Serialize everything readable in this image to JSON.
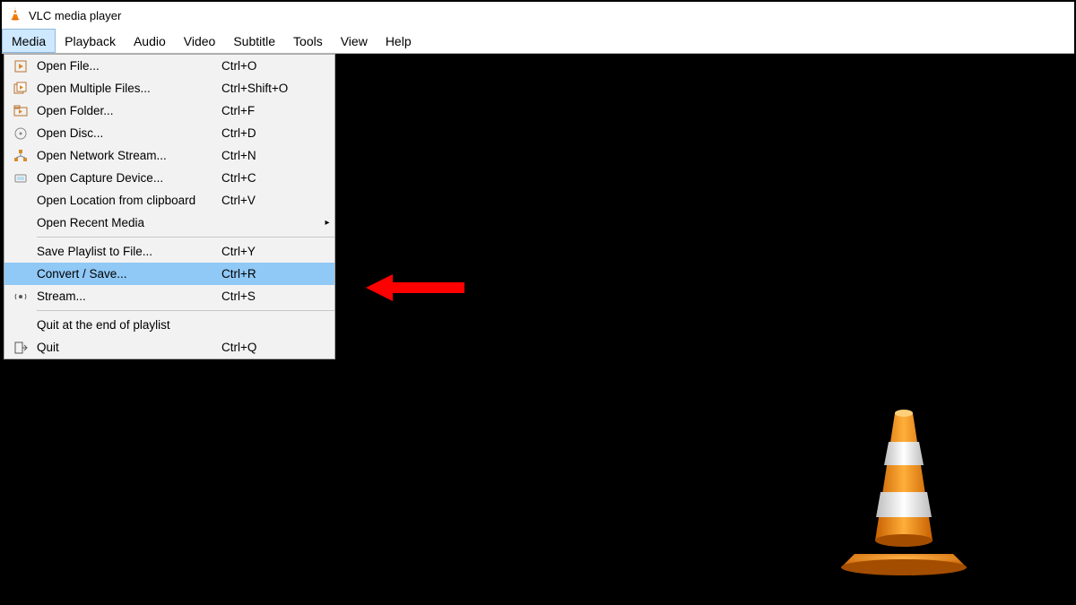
{
  "window": {
    "title": "VLC media player"
  },
  "menubar": {
    "items": [
      "Media",
      "Playback",
      "Audio",
      "Video",
      "Subtitle",
      "Tools",
      "View",
      "Help"
    ],
    "active_index": 0
  },
  "media_menu": {
    "groups": [
      [
        {
          "icon": "file-play-icon",
          "label": "Open File...",
          "shortcut": "Ctrl+O"
        },
        {
          "icon": "files-play-icon",
          "label": "Open Multiple Files...",
          "shortcut": "Ctrl+Shift+O"
        },
        {
          "icon": "folder-play-icon",
          "label": "Open Folder...",
          "shortcut": "Ctrl+F"
        },
        {
          "icon": "disc-icon",
          "label": "Open Disc...",
          "shortcut": "Ctrl+D"
        },
        {
          "icon": "network-icon",
          "label": "Open Network Stream...",
          "shortcut": "Ctrl+N"
        },
        {
          "icon": "capture-icon",
          "label": "Open Capture Device...",
          "shortcut": "Ctrl+C"
        },
        {
          "icon": "",
          "label": "Open Location from clipboard",
          "shortcut": "Ctrl+V"
        },
        {
          "icon": "",
          "label": "Open Recent Media",
          "shortcut": "",
          "submenu": true
        }
      ],
      [
        {
          "icon": "",
          "label": "Save Playlist to File...",
          "shortcut": "Ctrl+Y"
        },
        {
          "icon": "",
          "label": "Convert / Save...",
          "shortcut": "Ctrl+R",
          "highlight": true
        },
        {
          "icon": "stream-icon",
          "label": "Stream...",
          "shortcut": "Ctrl+S"
        }
      ],
      [
        {
          "icon": "",
          "label": "Quit at the end of playlist",
          "shortcut": ""
        },
        {
          "icon": "quit-icon",
          "label": "Quit",
          "shortcut": "Ctrl+Q"
        }
      ]
    ]
  }
}
